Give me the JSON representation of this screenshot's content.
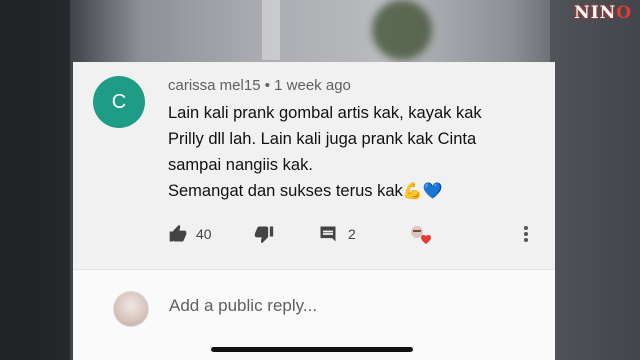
{
  "watermark": {
    "text_a": "NIN",
    "text_b": "O"
  },
  "comment": {
    "avatar_letter": "C",
    "author": "carissa mel15",
    "separator": "•",
    "time": "1 week ago",
    "lines": [
      "Lain kali prank gombal artis kak, kayak kak",
      "Prilly dll lah. Lain kali juga prank kak Cinta",
      "sampai nangiis kak.",
      "Semangat dan sukses terus kak"
    ],
    "emoji_1": "💪",
    "emoji_2": "💙",
    "likes": "40",
    "replies": "2"
  },
  "reply_box": {
    "placeholder": "Add a public reply..."
  },
  "colors": {
    "avatar_bg": "#1e9c86",
    "card_bg": "#f1f1f1",
    "creator_heart": "#e53935"
  },
  "icons": [
    "thumbs-up-icon",
    "thumbs-down-icon",
    "reply-comment-icon",
    "creator-heart-icon",
    "more-vert-icon"
  ]
}
